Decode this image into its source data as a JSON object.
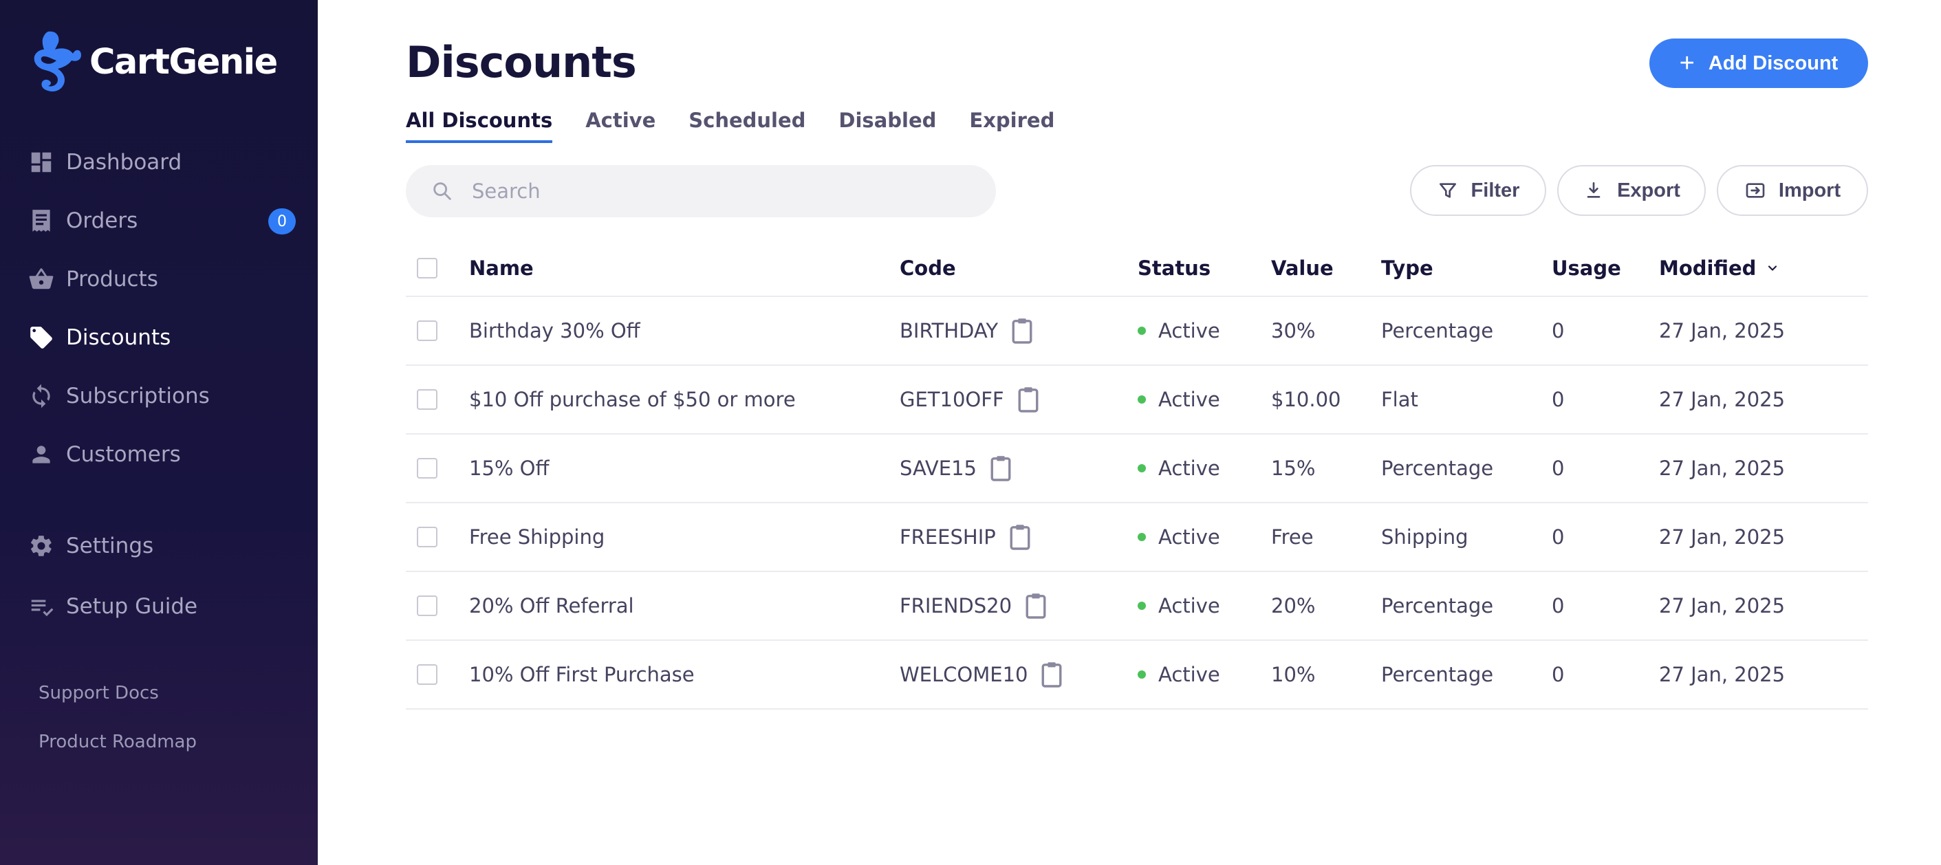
{
  "app": {
    "name": "CartGenie"
  },
  "sidebar": {
    "items": [
      {
        "label": "Dashboard",
        "icon": "dashboard-icon"
      },
      {
        "label": "Orders",
        "icon": "receipt-icon",
        "badge": "0"
      },
      {
        "label": "Products",
        "icon": "basket-icon"
      },
      {
        "label": "Discounts",
        "icon": "tag-icon",
        "active": true
      },
      {
        "label": "Subscriptions",
        "icon": "refresh-icon"
      },
      {
        "label": "Customers",
        "icon": "person-icon"
      },
      {
        "label": "Settings",
        "icon": "gear-icon"
      },
      {
        "label": "Setup Guide",
        "icon": "checklist-icon"
      }
    ],
    "links": [
      "Support Docs",
      "Product Roadmap"
    ]
  },
  "header": {
    "title": "Discounts",
    "add_button": "Add Discount"
  },
  "tabs": [
    "All Discounts",
    "Active",
    "Scheduled",
    "Disabled",
    "Expired"
  ],
  "active_tab": "All Discounts",
  "search": {
    "placeholder": "Search"
  },
  "toolbar": {
    "filter": "Filter",
    "export": "Export",
    "import": "Import"
  },
  "table": {
    "columns": [
      "Name",
      "Code",
      "Status",
      "Value",
      "Type",
      "Usage",
      "Modified"
    ],
    "sort_column": "Modified",
    "rows": [
      {
        "name": "Birthday 30% Off",
        "code": "BIRTHDAY",
        "status": "Active",
        "value": "30%",
        "type": "Percentage",
        "usage": "0",
        "modified": "27 Jan, 2025"
      },
      {
        "name": "$10 Off purchase of $50 or more",
        "code": "GET10OFF",
        "status": "Active",
        "value": "$10.00",
        "type": "Flat",
        "usage": "0",
        "modified": "27 Jan, 2025"
      },
      {
        "name": "15% Off",
        "code": "SAVE15",
        "status": "Active",
        "value": "15%",
        "type": "Percentage",
        "usage": "0",
        "modified": "27 Jan, 2025"
      },
      {
        "name": "Free Shipping",
        "code": "FREESHIP",
        "status": "Active",
        "value": "Free",
        "type": "Shipping",
        "usage": "0",
        "modified": "27 Jan, 2025"
      },
      {
        "name": "20% Off Referral",
        "code": "FRIENDS20",
        "status": "Active",
        "value": "20%",
        "type": "Percentage",
        "usage": "0",
        "modified": "27 Jan, 2025"
      },
      {
        "name": "10% Off First Purchase",
        "code": "WELCOME10",
        "status": "Active",
        "value": "10%",
        "type": "Percentage",
        "usage": "0",
        "modified": "27 Jan, 2025"
      }
    ]
  },
  "colors": {
    "sidebar_bg": "#181440",
    "accent": "#3a7ef5",
    "status_active": "#4cc15a"
  }
}
